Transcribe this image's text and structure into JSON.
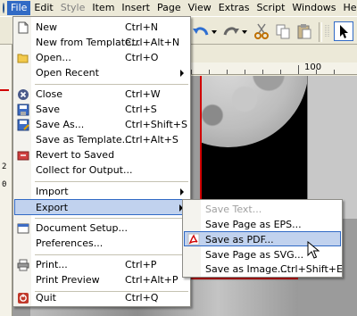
{
  "menubar": {
    "items": [
      {
        "label": "File"
      },
      {
        "label": "Edit"
      },
      {
        "label": "Style"
      },
      {
        "label": "Item"
      },
      {
        "label": "Insert"
      },
      {
        "label": "Page"
      },
      {
        "label": "View"
      },
      {
        "label": "Extras"
      },
      {
        "label": "Script"
      },
      {
        "label": "Windows"
      },
      {
        "label": "Help"
      }
    ]
  },
  "ruler": {
    "top_label": "100",
    "left_label_1": "2",
    "left_label_2": "0"
  },
  "file_menu": {
    "items": [
      {
        "label": "New",
        "shortcut": "Ctrl+N",
        "icon": "new-document-icon"
      },
      {
        "label": "New from Template...",
        "shortcut": "Ctrl+Alt+N"
      },
      {
        "label": "Open...",
        "shortcut": "Ctrl+O",
        "icon": "open-folder-icon"
      },
      {
        "label": "Open Recent",
        "submenu": true
      },
      {
        "label": "Close",
        "shortcut": "Ctrl+W",
        "icon": "close-icon"
      },
      {
        "label": "Save",
        "shortcut": "Ctrl+S",
        "icon": "save-icon"
      },
      {
        "label": "Save As...",
        "shortcut": "Ctrl+Shift+S",
        "icon": "save-as-icon"
      },
      {
        "label": "Save as Template...",
        "shortcut": "Ctrl+Alt+S"
      },
      {
        "label": "Revert to Saved",
        "icon": "revert-icon"
      },
      {
        "label": "Collect for Output..."
      },
      {
        "label": "Import",
        "submenu": true
      },
      {
        "label": "Export",
        "submenu": true,
        "highlighted": true
      },
      {
        "label": "Document Setup...",
        "icon": "document-setup-icon"
      },
      {
        "label": "Preferences..."
      },
      {
        "label": "Print...",
        "shortcut": "Ctrl+P",
        "icon": "printer-icon"
      },
      {
        "label": "Print Preview",
        "shortcut": "Ctrl+Alt+P"
      },
      {
        "label": "Quit",
        "shortcut": "Ctrl+Q",
        "icon": "quit-icon"
      }
    ]
  },
  "export_menu": {
    "items": [
      {
        "label": "Save Text...",
        "disabled": true
      },
      {
        "label": "Save Page as EPS..."
      },
      {
        "label": "Save as PDF...",
        "icon": "pdf-icon",
        "highlighted": true
      },
      {
        "label": "Save Page as SVG..."
      },
      {
        "label": "Save as Image...",
        "shortcut": "Ctrl+Shift+E"
      }
    ]
  },
  "colors": {
    "highlight": "#c1d2ee",
    "highlight_border": "#316ac5",
    "menu_active": "#316ac5",
    "guide_red": "#d10000"
  }
}
